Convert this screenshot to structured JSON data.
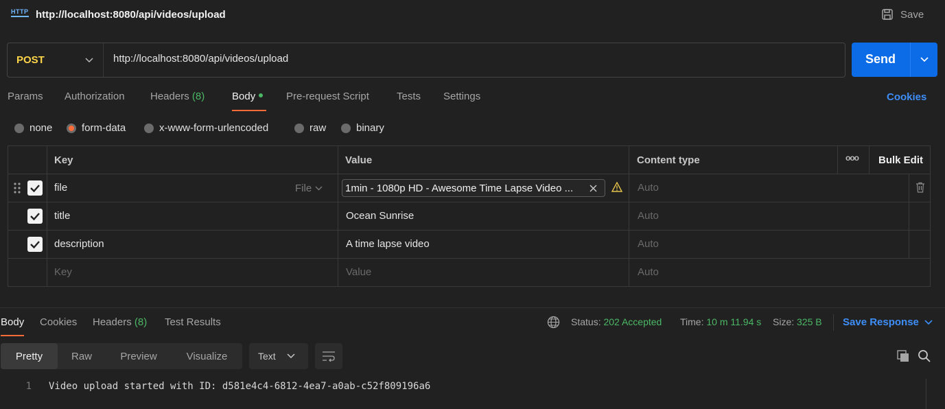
{
  "request": {
    "title": "http://localhost:8080/api/videos/upload",
    "icon_text": "HTTP",
    "save_label": "Save",
    "method": "POST",
    "url": "http://localhost:8080/api/videos/upload",
    "send_label": "Send"
  },
  "tabs": {
    "params": "Params",
    "authorization": "Authorization",
    "headers": "Headers",
    "headers_count": "(8)",
    "body": "Body",
    "prerequest": "Pre-request Script",
    "tests": "Tests",
    "settings": "Settings",
    "cookies": "Cookies"
  },
  "body_modes": {
    "none": "none",
    "form_data": "form-data",
    "urlencoded": "x-www-form-urlencoded",
    "raw": "raw",
    "binary": "binary",
    "selected": "form-data"
  },
  "form_table": {
    "headers": {
      "key": "Key",
      "value": "Value",
      "content_type": "Content type",
      "more": "ooo",
      "bulk_edit": "Bulk Edit"
    },
    "rows": [
      {
        "checked": true,
        "key": "file",
        "type": "File",
        "value": "1min - 1080p HD - Awesome Time Lapse Video ...",
        "content_type": "Auto"
      },
      {
        "checked": true,
        "key": "title",
        "value": "Ocean Sunrise",
        "content_type": "Auto"
      },
      {
        "checked": true,
        "key": "description",
        "value": "A time lapse video",
        "content_type": "Auto"
      }
    ],
    "placeholder": {
      "key": "Key",
      "value": "Value",
      "content_type": "Auto"
    }
  },
  "response": {
    "tabs": {
      "body": "Body",
      "cookies": "Cookies",
      "headers": "Headers",
      "headers_count": "(8)",
      "test_results": "Test Results"
    },
    "status_label": "Status:",
    "status_value": "202 Accepted",
    "time_label": "Time:",
    "time_value": "10 m 11.94 s",
    "size_label": "Size:",
    "size_value": "325 B",
    "save_response": "Save Response",
    "views": {
      "pretty": "Pretty",
      "raw": "Raw",
      "preview": "Preview",
      "visualize": "Visualize"
    },
    "format": "Text",
    "lines": [
      {
        "number": "1",
        "text": "Video upload started with ID: d581e4c4-6812-4ea7-a0ab-c52f809196a6"
      }
    ]
  },
  "colors": {
    "accent_orange": "#ff6c37",
    "send_blue": "#0c6ce8",
    "success_green": "#4cb865",
    "method_yellow": "#ffd54a",
    "link_blue": "#3e8ef8"
  }
}
